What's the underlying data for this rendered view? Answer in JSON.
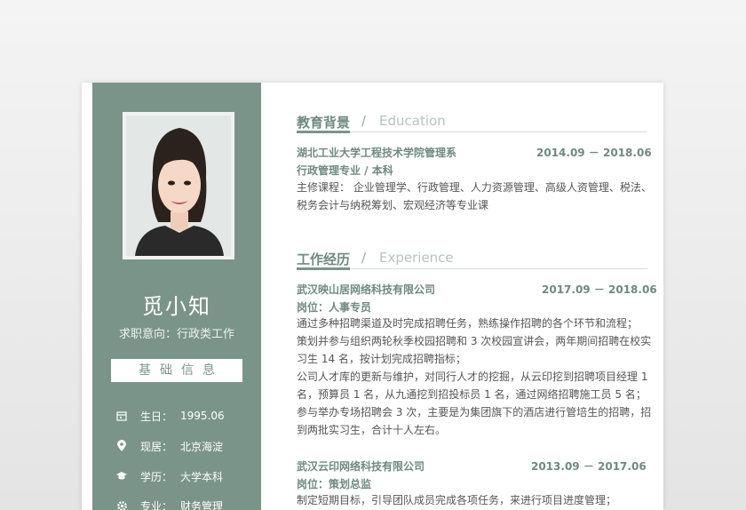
{
  "profile": {
    "name": "觅小知",
    "objective": "求职意向：行政类工作",
    "basic_title": "基础信息",
    "info": [
      {
        "icon": "calendar-icon",
        "label": "生日：",
        "value": "1995.06"
      },
      {
        "icon": "location-pin-icon",
        "label": "现居：",
        "value": "北京海淀"
      },
      {
        "icon": "graduation-cap-icon",
        "label": "学历：",
        "value": "大学本科"
      },
      {
        "icon": "gear-icon",
        "label": "专业：",
        "value": "财务管理"
      }
    ]
  },
  "education": {
    "title_cn": "教育背景",
    "slash": "/",
    "title_en": "Education",
    "school": "湖北工业大学工程技术学院管理系",
    "dates": "2014.09 － 2018.06",
    "major": "行政管理专业 / 本科",
    "courses": [
      "主修课程：  企业管理学、行政管理、人力资源管理、高级人资管理、税法、",
      "税务会计与纳税筹划、宏观经济等专业课"
    ]
  },
  "experience": {
    "title_cn": "工作经历",
    "slash": "/",
    "title_en": "Experience",
    "jobs": [
      {
        "company": "武汉映山居网络科技有限公司",
        "dates": "2017.09 － 2018.06",
        "position": "岗位：人事专员",
        "lines": [
          "通过多种招聘渠道及时完成招聘任务，熟练操作招聘的各个环节和流程；",
          "策划并参与组织两轮秋季校园招聘和 3 次校园宣讲会，两年期间招聘在校实",
          "习生 14 名，按计划完成招聘指标；",
          "公司人才库的更新与维护，对同行人才的挖掘，从云印挖到招聘项目经理 1",
          "名，预算员 1 名，从九通挖到招投标员 1 名，通过网络招聘施工员 5 名；",
          "参与举办专场招聘会 3 次，主要是为集团旗下的酒店进行管培生的招聘，招",
          "到两批实习生，合计十人左右。"
        ]
      },
      {
        "company": "武汉云印网络科技有限公司",
        "dates": "2013.09 － 2017.06",
        "position": "岗位：策划总监",
        "lines": [
          "制定短期目标，引导团队成员完成各项任务，来进行项目进度管理；"
        ]
      }
    ]
  },
  "colors": {
    "accent": "#7b948a",
    "accent_text": "#6f8a80",
    "body_text": "#555555"
  }
}
